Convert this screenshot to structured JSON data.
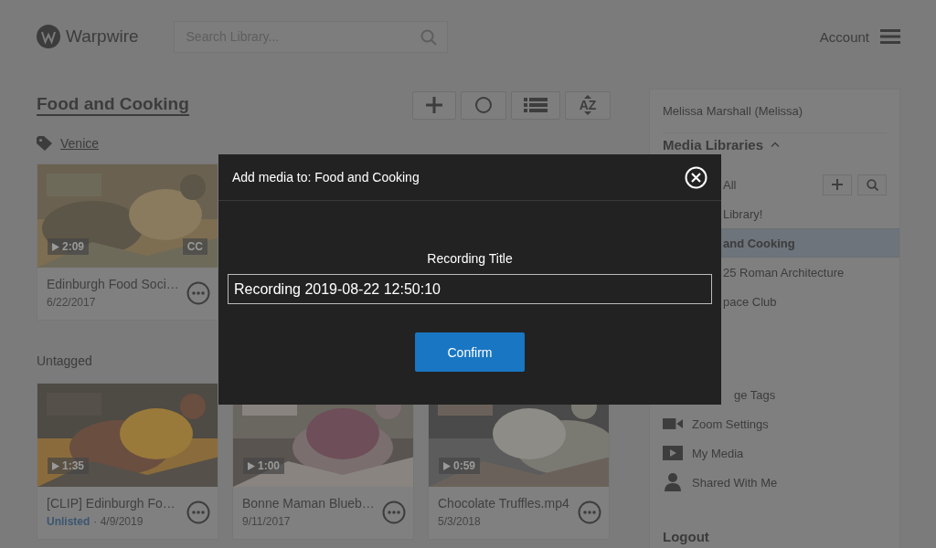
{
  "header": {
    "logo": "Warpwire",
    "search": {
      "placeholder": "Search Library..."
    },
    "account": "Account"
  },
  "library": {
    "title": "Food and Cooking",
    "toolbar": [
      {
        "kind": "add"
      },
      {
        "kind": "record"
      },
      {
        "kind": "list"
      },
      {
        "kind": "sort",
        "label": "AZ"
      }
    ],
    "groups": [
      {
        "tag": "Venice",
        "videos": [
          {
            "title": "Edinburgh Food Soci…",
            "date": "6/22/2017",
            "duration": "2:09",
            "captions": "CC"
          }
        ]
      },
      {
        "heading": "Untagged",
        "videos": [
          {
            "title": "[CLIP] Edinburgh Fo…",
            "status": "Unlisted",
            "date": "· 4/9/2019",
            "duration": "1:35"
          },
          {
            "title": "Bonne Maman Blueb…",
            "date": "9/11/2017",
            "duration": "1:00"
          },
          {
            "title": "Chocolate Truffles.mp4",
            "date": "5/3/2018",
            "duration": "0:59"
          }
        ]
      }
    ]
  },
  "sidebar": {
    "user": "Melissa Marshall (Melissa)",
    "libraries_heading": "Media Libraries",
    "expanded": true,
    "libraries": [
      {
        "label": "All",
        "selected": false
      },
      {
        "label": "Library!",
        "selected": false
      },
      {
        "label": "and Cooking",
        "selected": true
      },
      {
        "label": "25 Roman Architecture",
        "selected": false
      },
      {
        "label": "pace Club",
        "selected": false
      }
    ],
    "links": [
      {
        "kind": "tags",
        "label": "ge Tags"
      },
      {
        "kind": "zoom",
        "label": "Zoom Settings"
      },
      {
        "kind": "media",
        "label": "My Media"
      },
      {
        "kind": "shared",
        "label": "Shared With Me"
      }
    ],
    "logout": "Logout"
  },
  "modal": {
    "title": "Add media to: Food and Cooking",
    "field_label": "Recording Title",
    "value": "Recording 2019-08-22 12:50:10",
    "confirm": "Confirm"
  }
}
